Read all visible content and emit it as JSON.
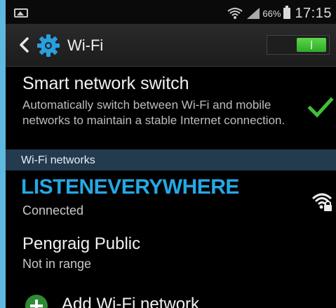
{
  "statusbar": {
    "battery_percent": "66%",
    "time": "17:15"
  },
  "actionbar": {
    "title": "Wi-Fi",
    "wifi_toggle_on": true
  },
  "smart_switch": {
    "title": "Smart network switch",
    "description": "Automatically switch between Wi-Fi and mobile networks to maintain a stable Internet connection.",
    "checked": true
  },
  "section": {
    "label": "Wi-Fi networks"
  },
  "networks": [
    {
      "name": "LISTENEVERYWHERE",
      "status": "Connected",
      "secured": true
    },
    {
      "name": "Pengraig Public",
      "status": "Not in range"
    }
  ],
  "add_network": {
    "label": "Add Wi-Fi network"
  },
  "colors": {
    "accent_blue": "#25a8e5",
    "toggle_green": "#3cc23a",
    "check_green": "#3fbf3a",
    "section_bg": "#243a4e",
    "page_bg": "#5fb8e0"
  }
}
